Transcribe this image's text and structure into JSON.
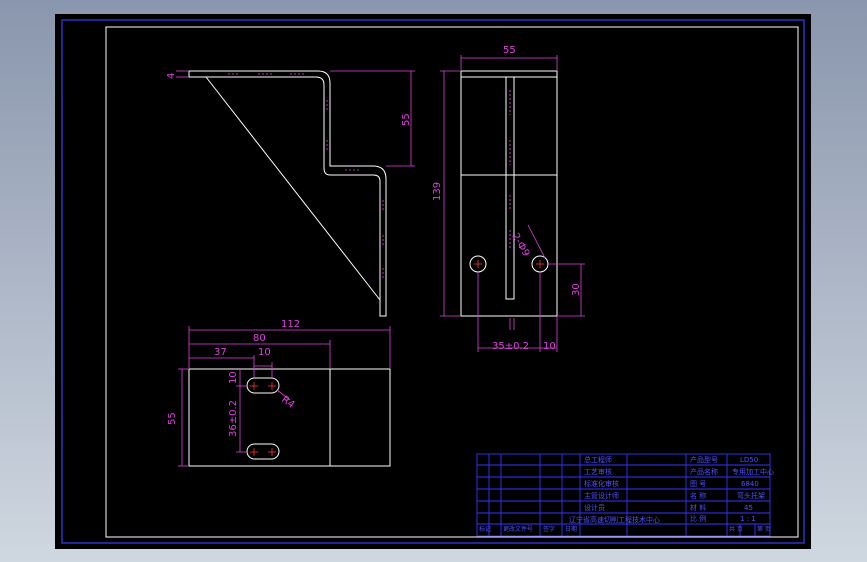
{
  "dimensions": {
    "top_view_width": "55",
    "side_height": "55",
    "thickness": "4",
    "front_height": "139",
    "hole_spec": "2-Ф9",
    "hole_height": "30",
    "hole_spacing": "35±0.2",
    "hole_edge": "10",
    "base_length": "112",
    "slot_end": "80",
    "slot_start": "37",
    "slot_width": "10",
    "slot_offset": "10",
    "slot_pitch": "36±0.2",
    "slot_radius": "R4",
    "base_width": "55"
  },
  "title_block": {
    "left_labels": [
      "总工程师",
      "工艺审核",
      "标准化审核",
      "主管设计师",
      "设计员"
    ],
    "right_labels": [
      "产品型号",
      "产品名称",
      "图    号",
      "名    称",
      "材    料",
      "比    例"
    ],
    "right_values": [
      "LD50",
      "专用加工中心",
      "6840",
      "弯头托架",
      "45",
      "1 : 1"
    ],
    "unit": "辽宁省高速切削工程技术中心",
    "bottom_row": [
      "标记",
      "更改文件号",
      "签字",
      "日期"
    ],
    "footer": [
      "共  页",
      "第  页"
    ]
  },
  "colors": {
    "background": "#000000",
    "outline": "#ffffff",
    "dimension": "#e040e0",
    "table": "#3535ff"
  }
}
